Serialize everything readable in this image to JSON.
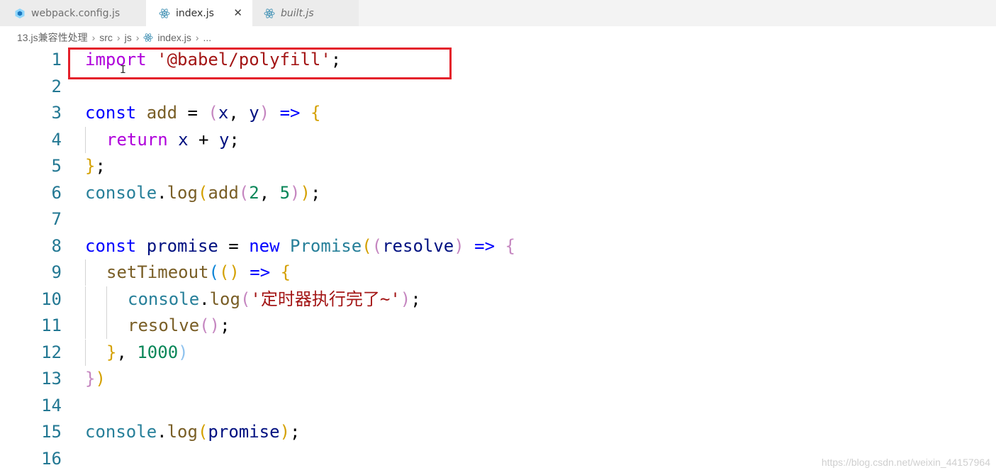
{
  "tabs": [
    {
      "label": "webpack.config.js",
      "icon": "webpack-icon"
    },
    {
      "label": "index.js",
      "icon": "react-atom-icon",
      "close": "✕"
    },
    {
      "label": "built.js",
      "icon": "react-atom-icon"
    }
  ],
  "breadcrumb": [
    "13.js兼容性处理",
    "src",
    "js",
    "index.js",
    "..."
  ],
  "code": {
    "line_numbers": [
      "1",
      "2",
      "3",
      "4",
      "5",
      "6",
      "7",
      "8",
      "9",
      "10",
      "11",
      "12",
      "13",
      "14",
      "15",
      "16"
    ],
    "line1": {
      "kw": "import",
      "str": "'@babel/polyfill'",
      "end": ";"
    },
    "line3": {
      "kw": "const",
      "name": "add",
      "eq": " = ",
      "open": "(",
      "p1": "x",
      "comma": ", ",
      "p2": "y",
      "close": ")",
      "arrow": " => ",
      "brace": "{"
    },
    "line4": {
      "kw": "return",
      "a": "x",
      "op": " + ",
      "b": "y",
      "end": ";"
    },
    "line5": {
      "brace": "}",
      "end": ";"
    },
    "line6": {
      "obj": "console",
      "dot": ".",
      "fn": "log",
      "o1": "(",
      "inner": "add",
      "o2": "(",
      "n1": "2",
      "comma": ", ",
      "n2": "5",
      "c2": ")",
      "c1": ")",
      "end": ";"
    },
    "line8": {
      "kw": "const",
      "name": "promise",
      "eq": " = ",
      "new": "new",
      "cls": "Promise",
      "o1": "(",
      "o2": "(",
      "param": "resolve",
      "c2": ")",
      "arrow": " => ",
      "brace": "{"
    },
    "line9": {
      "fn": "setTimeout",
      "o1": "(",
      "o2": "(",
      "c2": ")",
      "arrow": " => ",
      "brace": "{"
    },
    "line10": {
      "obj": "console",
      "dot": ".",
      "fn": "log",
      "o": "(",
      "str": "'定时器执行完了~'",
      "c": ")",
      "end": ";"
    },
    "line11": {
      "fn": "resolve",
      "o": "(",
      "c": ")",
      "end": ";"
    },
    "line12": {
      "brace": "}",
      "comma": ", ",
      "num": "1000",
      "c": ")"
    },
    "line13": {
      "brace": "}",
      "c": ")"
    },
    "line15": {
      "obj": "console",
      "dot": ".",
      "fn": "log",
      "o": "(",
      "arg": "promise",
      "c": ")",
      "end": ";"
    }
  },
  "cursor_glyph": "I",
  "watermark": "https://blog.csdn.net/weixin_44157964",
  "colors": {
    "highlight_box": "#e4202b",
    "line_number": "#237893",
    "keyword_control": "#af00db",
    "keyword_storage": "#0000ff",
    "string": "#a31515"
  }
}
